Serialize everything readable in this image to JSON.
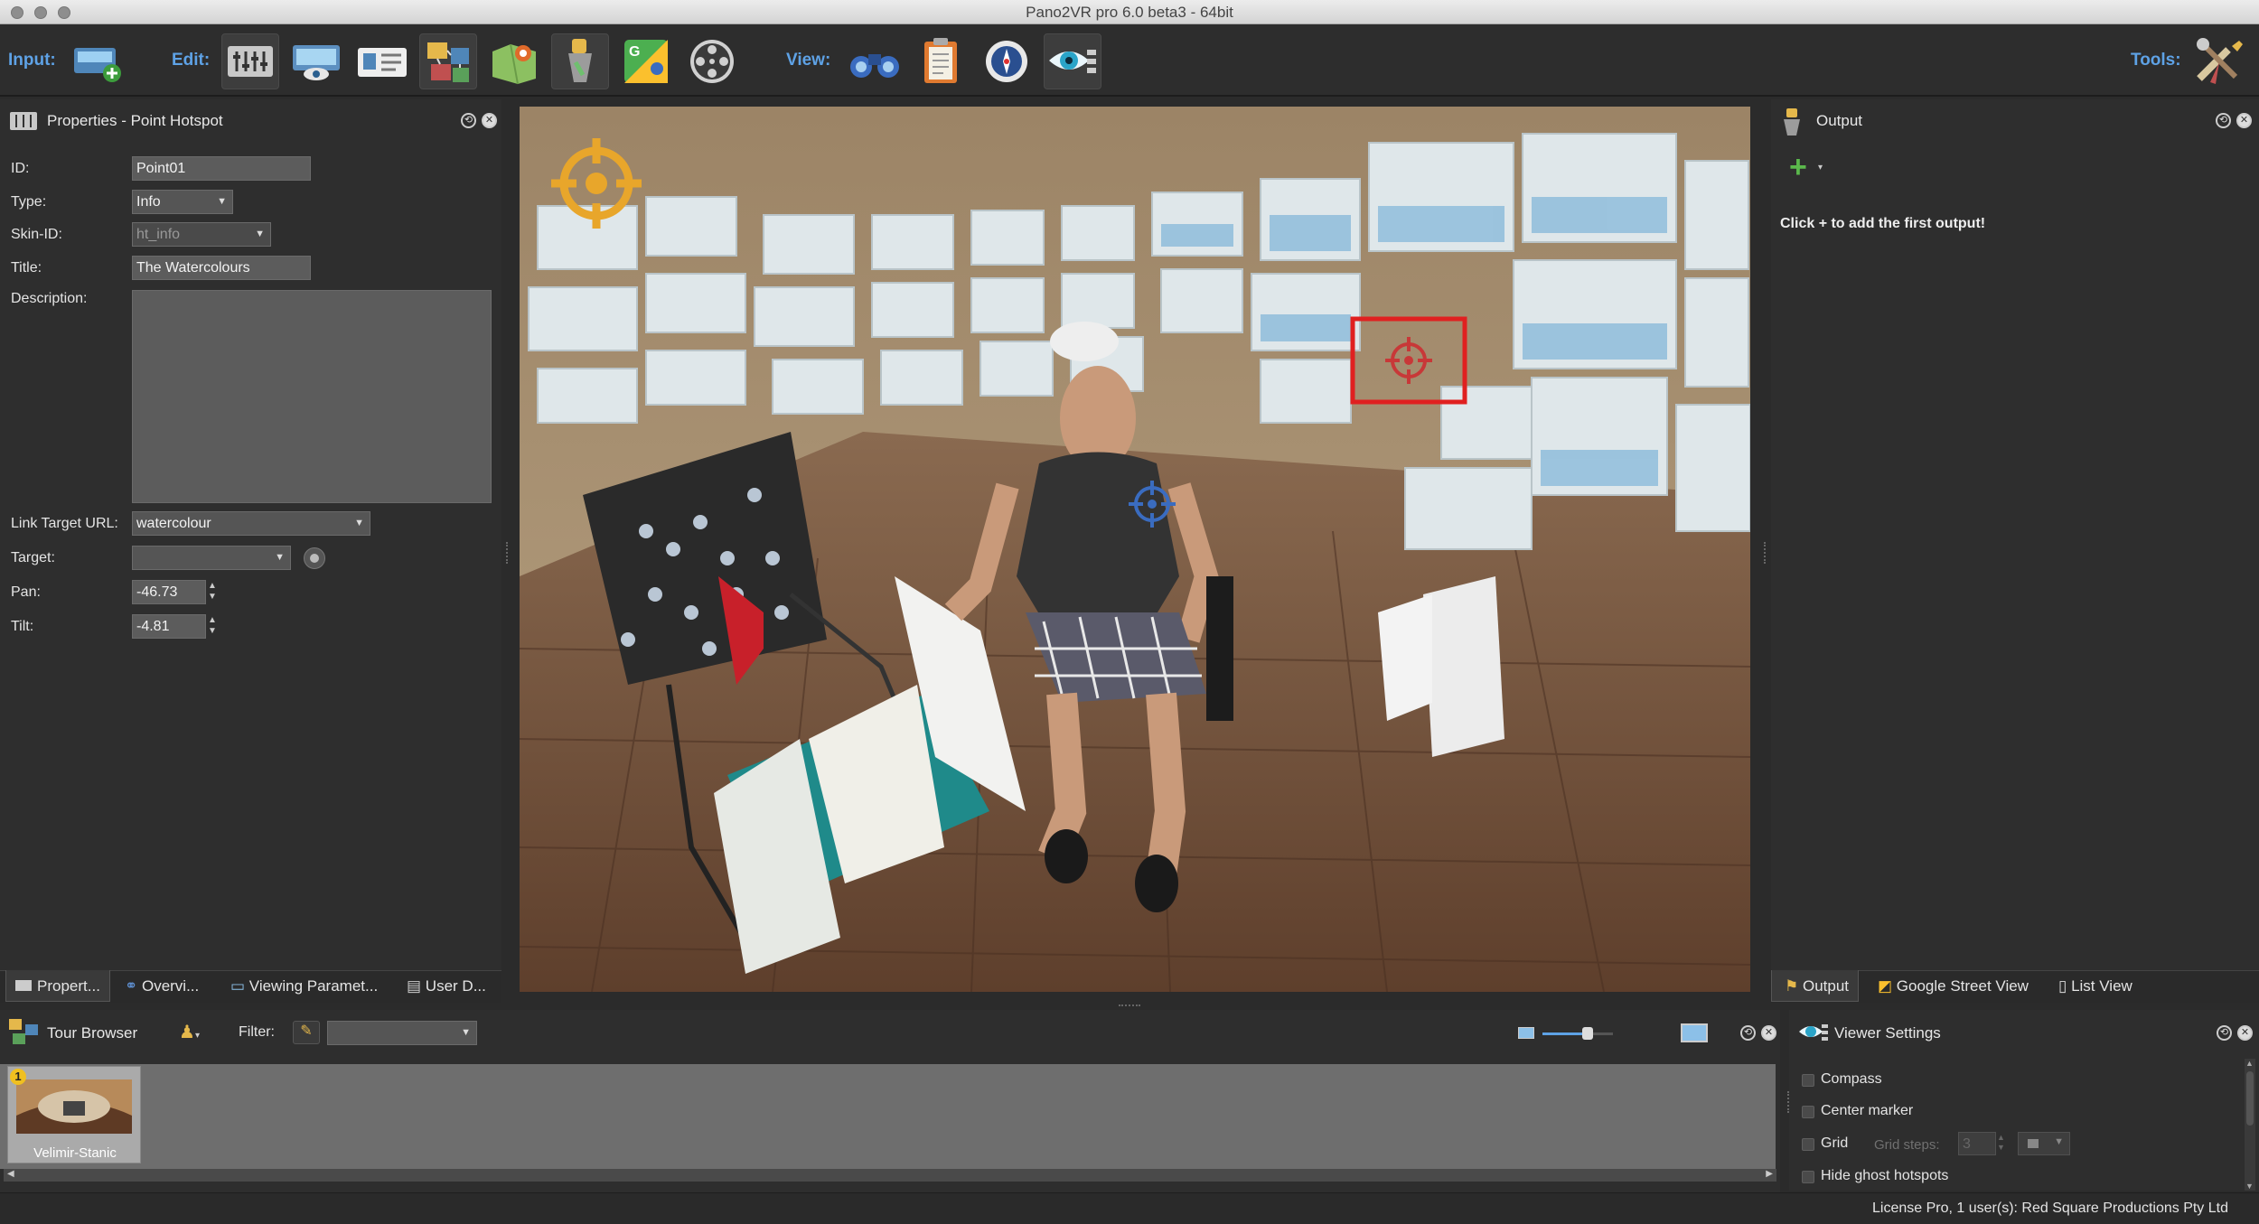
{
  "window": {
    "title": "Pano2VR pro 6.0 beta3 - 64bit"
  },
  "toolbar": {
    "input_label": "Input:",
    "edit_label": "Edit:",
    "view_label": "View:",
    "tools_label": "Tools:",
    "icons": [
      "add-panorama-icon",
      "tour-adjust-icon",
      "viewing-params-icon",
      "user-data-icon",
      "tour-map-icon",
      "floor-plan-icon",
      "hotspot-edit-icon",
      "google-maps-icon",
      "film-reel-icon",
      "binoculars-icon",
      "clipboard-icon",
      "compass-icon",
      "viewer-eye-icon",
      "tools-icon"
    ]
  },
  "properties": {
    "title": "Properties - Point Hotspot",
    "id_label": "ID:",
    "id_value": "Point01",
    "type_label": "Type:",
    "type_value": "Info",
    "skin_label": "Skin-ID:",
    "skin_value": "ht_info",
    "title_label": "Title:",
    "title_value": "The Watercolours",
    "desc_label": "Description:",
    "link_label": "Link Target URL:",
    "link_value": "watercolour",
    "target_label": "Target:",
    "target_value": "",
    "pan_label": "Pan:",
    "pan_value": "-46.73",
    "tilt_label": "Tilt:",
    "tilt_value": "-4.81",
    "tabs": [
      "Propert...",
      "Overvi...",
      "Viewing Paramet...",
      "User D..."
    ]
  },
  "output": {
    "title": "Output",
    "hint": "Click + to add the first output!",
    "tabs": [
      "Output",
      "Google Street View",
      "List View"
    ]
  },
  "tour_browser": {
    "title": "Tour Browser",
    "filter_label": "Filter:",
    "filter_value": "",
    "thumb_label": "Velimir-Stanic",
    "thumb_badge": "1"
  },
  "viewer_settings": {
    "title": "Viewer Settings",
    "compass": "Compass",
    "center_marker": "Center marker",
    "grid": "Grid",
    "grid_steps_label": "Grid steps:",
    "grid_steps_value": "3",
    "hide_ghost": "Hide ghost hotspots"
  },
  "status": {
    "license": "License Pro, 1 user(s): Red Square Productions Pty Ltd"
  },
  "colors": {
    "accent_blue": "#5ea2e6",
    "hotspot_gold": "#e8a62b",
    "selection_red": "#e02020",
    "hotspot_blue": "#3a6cc0"
  }
}
